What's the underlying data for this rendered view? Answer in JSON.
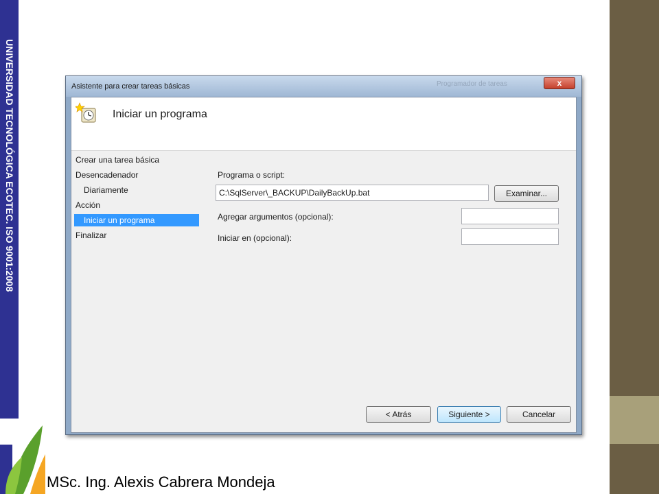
{
  "slide": {
    "side_banner": "UNIVERSIDAD TECNOLÓGICA ECOTEC. ISO 9001:2008",
    "author": "MSc. Ing. Alexis Cabrera Mondeja"
  },
  "window": {
    "title": "Asistente para crear tareas básicas",
    "background_window_title": "Programador de tareas",
    "close_label": "x"
  },
  "header": {
    "title": "Iniciar un programa",
    "icon": "clock-task-icon"
  },
  "steps": [
    {
      "label": "Crear una tarea básica",
      "selected": false
    },
    {
      "label": "Desencadenador",
      "selected": false
    },
    {
      "label": "Diariamente",
      "selected": false
    },
    {
      "label": "Acción",
      "selected": false
    },
    {
      "label": "Iniciar un programa",
      "selected": true
    },
    {
      "label": "Finalizar",
      "selected": false
    }
  ],
  "form": {
    "program_label": "Programa o script:",
    "program_value": "C:\\SqlServer\\_BACKUP\\DailyBackUp.bat",
    "browse_label": "Examinar...",
    "args_label": "Agregar argumentos (opcional):",
    "args_value": "",
    "start_in_label": "Iniciar en (opcional):",
    "start_in_value": ""
  },
  "buttons": {
    "back": "< Atrás",
    "next": "Siguiente >",
    "cancel": "Cancelar"
  },
  "colors": {
    "banner": "#2e3192",
    "stripe_dark": "#6b5e44",
    "stripe_light": "#a8a07a",
    "selection": "#3399ff"
  }
}
